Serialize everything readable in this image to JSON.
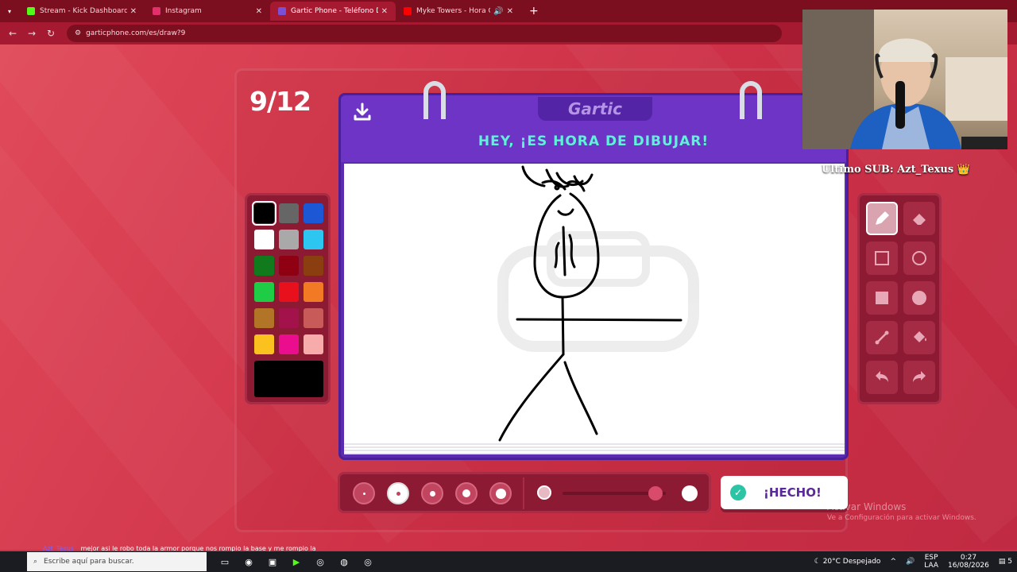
{
  "browser": {
    "tabs": [
      {
        "title": "Stream - Kick Dashboard",
        "fav_color": "#53fc18"
      },
      {
        "title": "Instagram",
        "fav_color": "#e1306c"
      },
      {
        "title": "Gartic Phone - Teléfono Desco",
        "fav_color": "#7b4fd6"
      },
      {
        "title": "Myke Towers - Hora Cero (",
        "fav_color": "#ff0000"
      }
    ],
    "new_tab": "+",
    "url": "garticphone.com/es/draw?9"
  },
  "game": {
    "round": "9/12",
    "logo": "Gartic",
    "title": "HEY, ¡ES HORA DE DIBUJAR!",
    "done_label": "¡HECHO!",
    "current_color": "#000000",
    "palette": [
      "#000000",
      "#666666",
      "#1c58d6",
      "#ffffff",
      "#a9a9a9",
      "#2cc6f0",
      "#117a1d",
      "#8f0012",
      "#8b3e0f",
      "#1ecc45",
      "#e8101d",
      "#f27a24",
      "#b27427",
      "#a3124a",
      "#c85a5a",
      "#fbc11e",
      "#ea0e8f",
      "#f7acab"
    ],
    "selected_size_index": 1,
    "opacity_level": 0.9
  },
  "overlay": {
    "last_sub": "Ultimo SUB: Azt_Texus 👑"
  },
  "watermark": {
    "line1": "Activar Windows",
    "line2": "Ve a Configuración para activar Windows."
  },
  "chat": {
    "user": "Azt_Texus",
    "message": "mejor asi le robo toda la armor porque nos rompio la base y me rompio la"
  },
  "taskbar": {
    "search_placeholder": "Escribe aquí para buscar.",
    "weather": "20°C  Despejado",
    "lang": "ESP",
    "lang2": "LAA",
    "time": "0:27",
    "date": "16/08/2026",
    "notifications": "5"
  }
}
